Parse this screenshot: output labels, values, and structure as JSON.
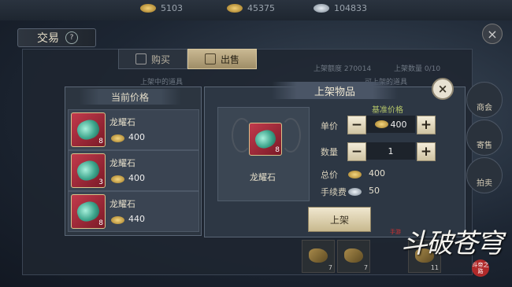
{
  "currency_bar": {
    "gold": "5103",
    "bound_gold": "45375",
    "silver": "104833"
  },
  "trade": {
    "title": "交易",
    "help": "?",
    "tabs": {
      "buy": "购买",
      "sell": "出售"
    },
    "faint_listed_label": "上架中的道具",
    "faint_listable_label": "可上架的道具",
    "faint_listing_quota": "上架额度 270014",
    "faint_listing_count": "上架数量 0/10"
  },
  "side_menu": {
    "trade_guild": "商会",
    "sell": "寄售",
    "auction": "拍卖"
  },
  "price_panel": {
    "header": "当前价格",
    "rows": [
      {
        "name": "龙耀石",
        "qty": "8",
        "price": "400"
      },
      {
        "name": "龙耀石",
        "qty": "3",
        "price": "400"
      },
      {
        "name": "龙耀石",
        "qty": "8",
        "price": "440"
      }
    ]
  },
  "list_dialog": {
    "header": "上架物品",
    "close": "×",
    "item": {
      "name": "龙耀石",
      "qty": "8"
    },
    "reference_price_label": "基准价格",
    "unit_price_label": "单价",
    "unit_price_value": "400",
    "quantity_label": "数量",
    "quantity_value": "1",
    "total_label": "总价",
    "total_value": "400",
    "fee_label": "手续费",
    "fee_value": "50",
    "minus": "−",
    "plus": "+",
    "submit": "上架"
  },
  "bottom_items": [
    "7",
    "7",
    "11"
  ],
  "logo": {
    "main": "斗破苍穹",
    "sub": "斗帝之路",
    "seal": "手游"
  },
  "close_main": "×"
}
